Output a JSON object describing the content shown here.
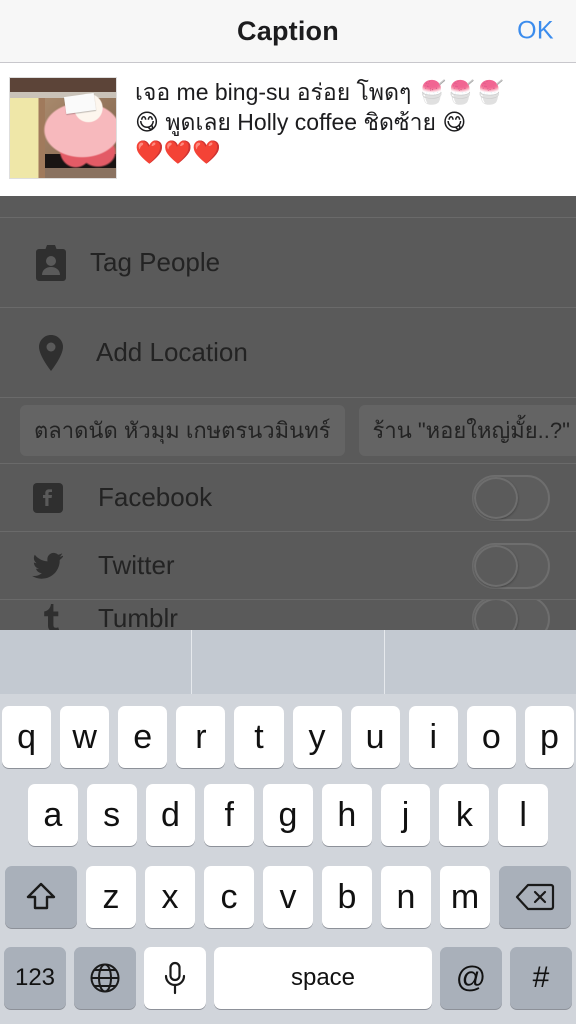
{
  "header": {
    "title": "Caption",
    "ok_label": "OK"
  },
  "caption": {
    "thumbnail_alt": "strawberry-bingsu-photo",
    "line1": "เจอ me bing-su อร่อย โพดๆ 🍧🍧🍧",
    "line2": "😋 พูดเลย Holly coffee ชิดซ้าย 😋",
    "line3": "❤️❤️❤️"
  },
  "options": {
    "tag_people": {
      "label": "Tag People",
      "icon": "person-badge-icon"
    },
    "add_location": {
      "label": "Add Location",
      "icon": "map-pin-icon"
    },
    "location_chips": [
      "ตลาดนัด หัวมุม เกษตรนวมินทร์",
      "ร้าน \"หอยใหญ่มั้ย..?\""
    ],
    "social": [
      {
        "label": "Facebook",
        "icon": "facebook-icon",
        "enabled": false
      },
      {
        "label": "Twitter",
        "icon": "twitter-icon",
        "enabled": false
      },
      {
        "label": "Tumblr",
        "icon": "tumblr-icon",
        "enabled": false
      }
    ]
  },
  "keyboard": {
    "suggestions": [
      "",
      "",
      ""
    ],
    "row1": [
      "q",
      "w",
      "e",
      "r",
      "t",
      "y",
      "u",
      "i",
      "o",
      "p"
    ],
    "row2": [
      "a",
      "s",
      "d",
      "f",
      "g",
      "h",
      "j",
      "k",
      "l"
    ],
    "row3": [
      "z",
      "x",
      "c",
      "v",
      "b",
      "n",
      "m"
    ],
    "shift_icon": "shift-arrow-icon",
    "backspace_icon": "backspace-icon",
    "numbers_label": "123",
    "globe_icon": "globe-icon",
    "mic_icon": "microphone-icon",
    "space_label": "space",
    "at_label": "@",
    "hash_label": "#"
  },
  "colors": {
    "accent_blue": "#3b8ced",
    "dim_overlay": "#5a5a5a",
    "keyboard_bg": "#d1d5db",
    "key_gray": "#a9b0ba"
  }
}
